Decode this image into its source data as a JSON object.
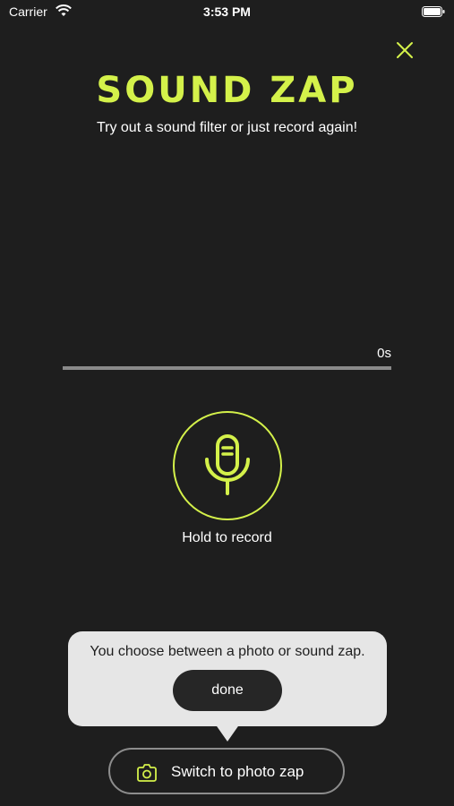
{
  "status_bar": {
    "carrier": "Carrier",
    "time": "3:53 PM",
    "wifi_icon": "wifi-icon",
    "battery_icon": "battery-icon"
  },
  "header": {
    "close_icon": "close-icon",
    "title": "SOUND ZAP",
    "subtitle": "Try out a sound filter or just record again!"
  },
  "recorder": {
    "duration": "0s",
    "progress": 0,
    "mic_icon": "microphone-icon",
    "hold_label": "Hold to record"
  },
  "tooltip": {
    "text": "You choose between a photo or sound zap.",
    "done_label": "done"
  },
  "switch_button": {
    "icon": "camera-icon",
    "label": "Switch to photo zap"
  },
  "colors": {
    "background": "#1e1e1e",
    "accent": "#d4f14a",
    "tooltip_bg": "#e6e6e6",
    "done_bg": "#262626"
  }
}
